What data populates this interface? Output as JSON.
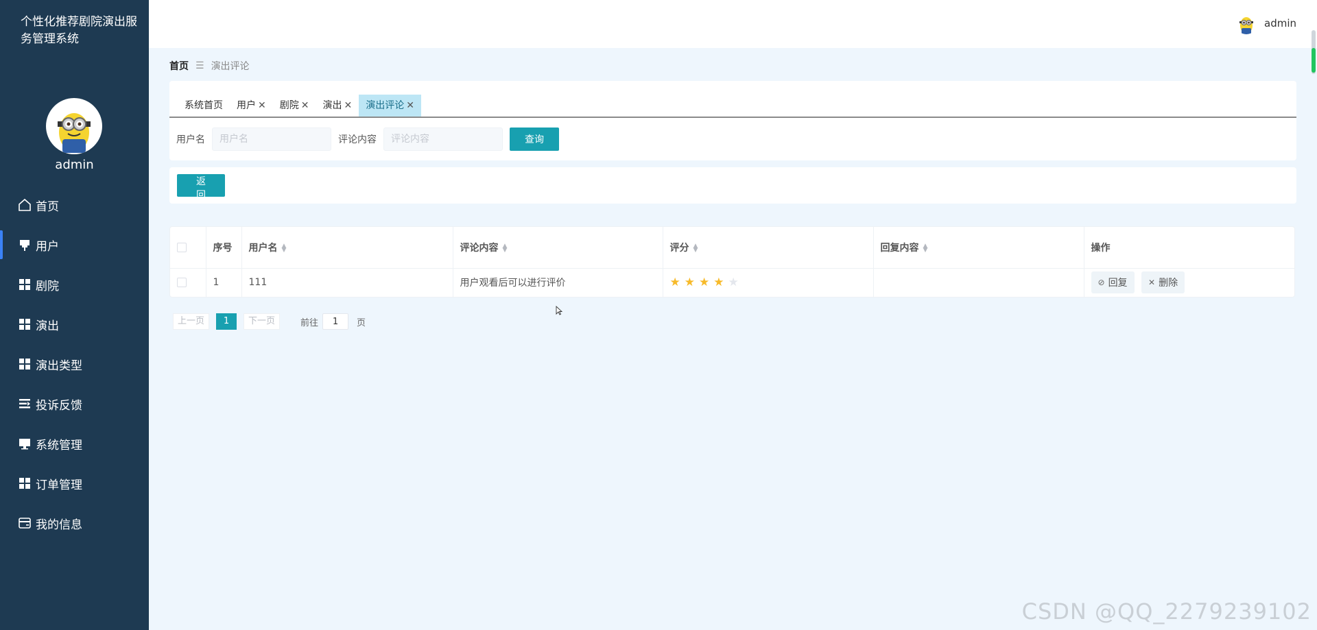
{
  "app": {
    "title": "个性化推荐剧院演出服务管理系统"
  },
  "sidebar": {
    "username": "admin",
    "items": [
      {
        "label": "首页",
        "icon": "home-icon"
      },
      {
        "label": "用户",
        "icon": "pin-icon",
        "active": true
      },
      {
        "label": "剧院",
        "icon": "grid-icon"
      },
      {
        "label": "演出",
        "icon": "grid-icon"
      },
      {
        "label": "演出类型",
        "icon": "grid-icon"
      },
      {
        "label": "投诉反馈",
        "icon": "list-icon"
      },
      {
        "label": "系统管理",
        "icon": "monitor-icon"
      },
      {
        "label": "订单管理",
        "icon": "grid-icon"
      },
      {
        "label": "我的信息",
        "icon": "card-icon"
      }
    ]
  },
  "topbar": {
    "username": "admin"
  },
  "breadcrumb": {
    "home": "首页",
    "current": "演出评论"
  },
  "tabs": [
    {
      "label": "系统首页",
      "closable": false
    },
    {
      "label": "用户",
      "closable": true
    },
    {
      "label": "剧院",
      "closable": true
    },
    {
      "label": "演出",
      "closable": true
    },
    {
      "label": "演出评论",
      "closable": true,
      "active": true
    }
  ],
  "search": {
    "username_label": "用户名",
    "username_placeholder": "用户名",
    "content_label": "评论内容",
    "content_placeholder": "评论内容",
    "query_button": "查询"
  },
  "actions": {
    "back_button": "返回"
  },
  "table": {
    "columns": [
      "序号",
      "用户名",
      "评论内容",
      "评分",
      "回复内容",
      "操作"
    ],
    "rows": [
      {
        "index": "1",
        "username": "111",
        "content": "用户观看后可以进行评价",
        "rating": 4,
        "rating_max": 5,
        "reply": ""
      }
    ],
    "reply_button": "回复",
    "delete_button": "删除"
  },
  "pagination": {
    "prev": "上一页",
    "current": "1",
    "next": "下一页",
    "goto_label": "前往",
    "goto_value": "1",
    "page_suffix": "页"
  },
  "watermark": "CSDN @QQ_2279239102",
  "colors": {
    "sidebar": "#1e3a52",
    "primary": "#18a0b0",
    "star": "#f7ba2a",
    "background": "#eef6fd"
  }
}
